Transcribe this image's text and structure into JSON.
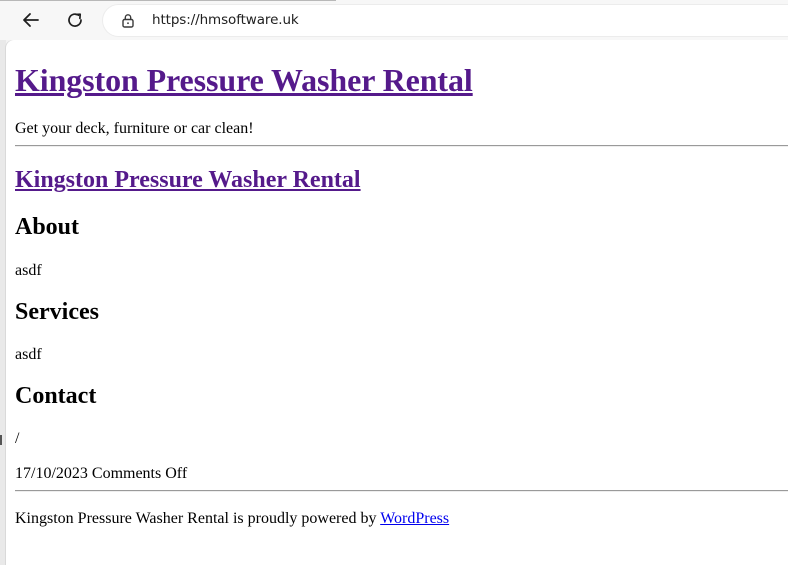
{
  "browser": {
    "url": "https://hmsoftware.uk",
    "icons": {
      "back": "back-arrow-icon",
      "reload": "reload-icon",
      "site_info": "lock-icon"
    }
  },
  "site": {
    "title": "Kingston Pressure Washer Rental",
    "tagline": "Get your deck, furniture or car clean!"
  },
  "post": {
    "title": "Kingston Pressure Washer Rental",
    "sections": [
      {
        "heading": "About",
        "text": "asdf"
      },
      {
        "heading": "Services",
        "text": "asdf"
      },
      {
        "heading": "Contact",
        "text": "/"
      }
    ],
    "date": "17/10/2023",
    "comments": "Comments Off"
  },
  "footer": {
    "text": "Kingston Pressure Washer Rental is proudly powered by ",
    "link_label": "WordPress"
  },
  "colors": {
    "visited_link": "#551a8b",
    "link": "#0000ee",
    "chrome_bg": "#f7f7f7"
  }
}
